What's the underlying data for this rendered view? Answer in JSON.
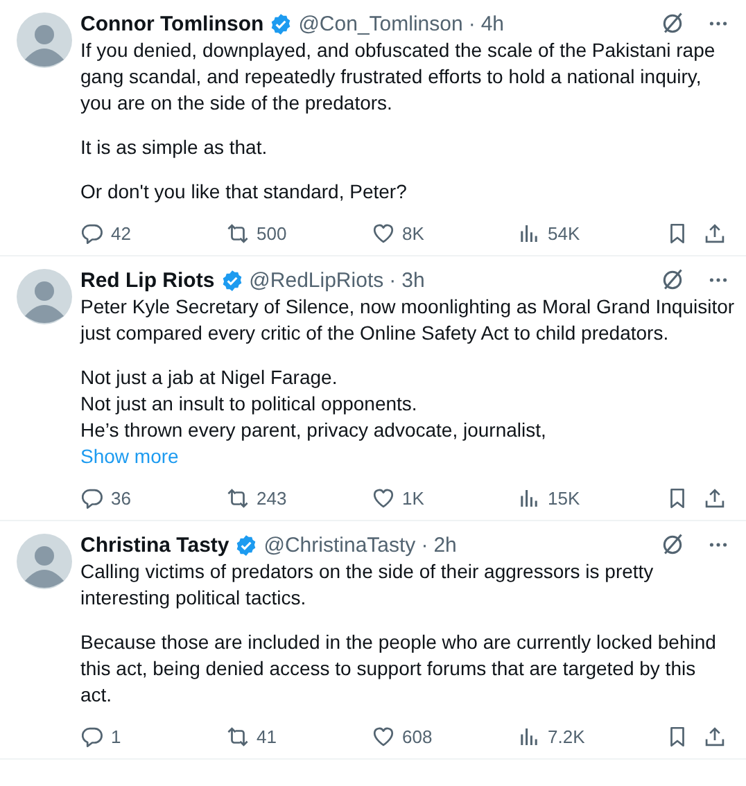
{
  "tweets": [
    {
      "name": "Connor Tomlinson",
      "verified": true,
      "handle": "@Con_Tomlinson",
      "separator": "·",
      "time": "4h",
      "paragraphs": [
        [
          "If you denied, downplayed, and obfuscated the scale of the Pakistani rape",
          "gang scandal, and repeatedly frustrated efforts to hold a national inquiry,",
          "you are on the side of the predators."
        ],
        [
          "It is as simple as that."
        ],
        [
          "Or don't you like that standard, Peter?"
        ]
      ],
      "replies": "42",
      "reposts": "500",
      "likes": "8K",
      "views": "54K"
    },
    {
      "name": "Red Lip Riots",
      "verified": true,
      "handle": "@RedLipRiots",
      "separator": "·",
      "time": "3h",
      "paragraphs": [
        [
          "Peter Kyle Secretary of Silence, now moonlighting as Moral Grand Inquisitor",
          "just compared every critic of the Online Safety Act to child predators."
        ],
        [
          "Not just a jab at Nigel Farage.",
          "Not just an insult to political opponents.",
          "He’s thrown every parent, privacy advocate, journalist,"
        ]
      ],
      "show_more": "Show more",
      "replies": "36",
      "reposts": "243",
      "likes": "1K",
      "views": "15K"
    },
    {
      "name": "Christina Tasty",
      "verified": true,
      "handle": "@ChristinaTasty",
      "separator": "·",
      "time": "2h",
      "paragraphs": [
        [
          "Calling victims of predators on the side of their aggressors is pretty",
          "interesting political tactics."
        ],
        [
          "Because those are included in the people who are currently locked behind",
          "this act, being denied access to support forums that are targeted by this",
          "act."
        ]
      ],
      "replies": "1",
      "reposts": "41",
      "likes": "608",
      "views": "7.2K"
    }
  ]
}
